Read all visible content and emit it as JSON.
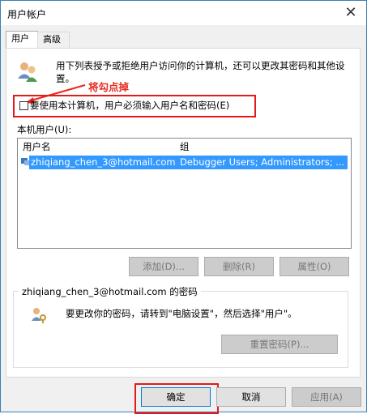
{
  "window": {
    "title": "用户帐户",
    "close_symbol": "✕"
  },
  "tabs": [
    {
      "label": "用户"
    },
    {
      "label": "高级"
    }
  ],
  "description": "用下列表授予或拒绝用户访问你的计算机，还可以更改其密码和其他设置。",
  "annotation": "将勾点掉",
  "checkbox": {
    "label": "要使用本计算机，用户必须输入用户名和密码(E)",
    "checked": false
  },
  "users_section": {
    "label": "本机用户(U):",
    "columns": [
      "用户名",
      "组"
    ],
    "rows": [
      {
        "name": "zhiqiang_chen_3@hotmail.com",
        "group": "Debugger Users; Administrators; ..."
      }
    ]
  },
  "list_buttons": {
    "add": "添加(D)...",
    "remove": "删除(R)",
    "properties": "属性(O)"
  },
  "password_group": {
    "title": "zhiqiang_chen_3@hotmail.com 的密码",
    "text": "要更改你的密码，请转到\"电脑设置\"，然后选择\"用户\"。",
    "reset_button": "重置密码(P)..."
  },
  "footer": {
    "ok": "确定",
    "cancel": "取消",
    "apply": "应用(A)"
  }
}
